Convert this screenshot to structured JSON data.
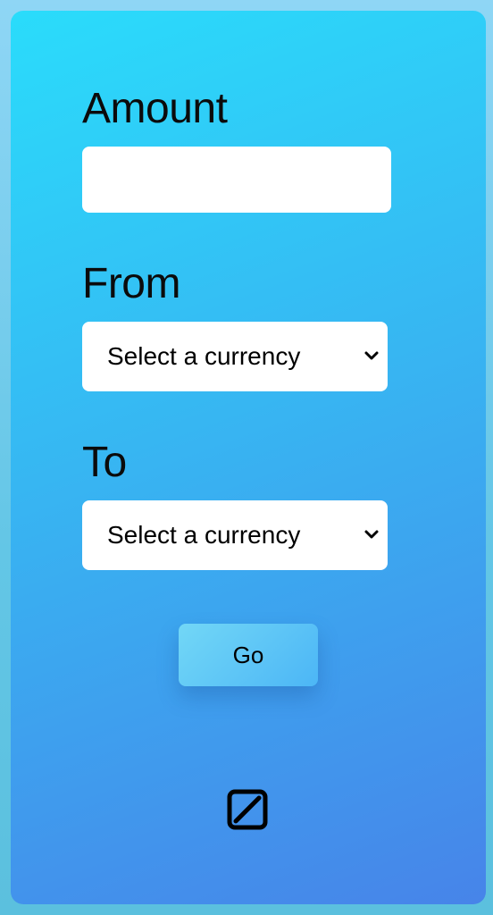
{
  "form": {
    "amount_label": "Amount",
    "amount_value": "",
    "from_label": "From",
    "from_selected": "Select a currency",
    "to_label": "To",
    "to_selected": "Select a currency",
    "go_label": "Go"
  },
  "icons": {
    "select_chevron": "chevron-down-icon",
    "bottom_icon": "toggle-icon"
  },
  "colors": {
    "card_gradient_start": "#2adcfb",
    "card_gradient_end": "#4784e9",
    "button_gradient_start": "#72d7f6",
    "button_gradient_end": "#4cb6f6"
  }
}
